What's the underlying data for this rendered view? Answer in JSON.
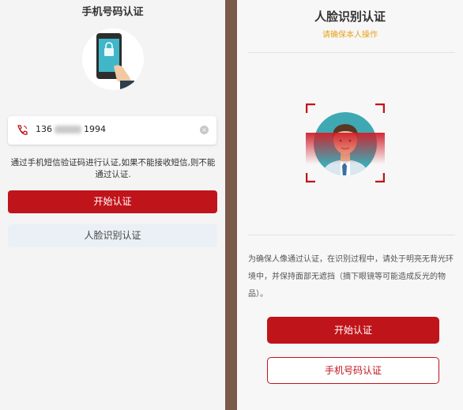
{
  "left": {
    "title": "手机号码认证",
    "phone_prefix": "136",
    "phone_suffix": "1994",
    "hint": "通过手机短信验证码进行认证,如果不能接收短信,则不能通过认证.",
    "start_button": "开始认证",
    "switch_button": "人脸识别认证"
  },
  "right": {
    "title": "人脸识别认证",
    "subtitle": "请确保本人操作",
    "hint": "为确保人像通过认证，在识别过程中，请处于明亮无背光环境中，并保持面部无遮挡（摘下眼镜等可能造成反光的物品）。",
    "start_button": "开始认证",
    "switch_button": "手机号码认证"
  },
  "colors": {
    "accent_red": "#c0141b",
    "subtitle_orange": "#e8a21a",
    "panel_bg": "#f4f4f4",
    "divider_brown": "#7a5a48"
  },
  "icons": {
    "phone_illustration": "phone-lock-icon",
    "phone_field": "phone-icon",
    "clear_field": "clear-icon",
    "face_illustration": "face-scan-icon"
  }
}
